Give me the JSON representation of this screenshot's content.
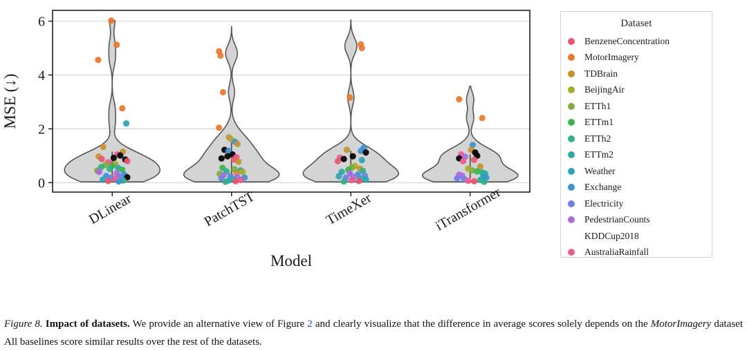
{
  "figure": {
    "caption_label": "Figure 8.",
    "caption_bold": "Impact of datasets.",
    "caption_part1": " We provide an alternative view of Figure ",
    "caption_link": "2",
    "caption_part2": " and clearly visualize that the difference in average scores solely depends on the ",
    "caption_italic": "MotorImagery",
    "caption_part3": " dataset All baselines score similar results over the rest of the datasets.",
    "link_color": "#1f4fd8"
  },
  "legend": {
    "title": "Dataset",
    "items": [
      {
        "label": "BenzeneConcentration",
        "color": "#e8566f"
      },
      {
        "label": "MotorImagery",
        "color": "#e8762c"
      },
      {
        "label": "TDBrain",
        "color": "#c4932e"
      },
      {
        "label": "BeijingAir",
        "color": "#a9ab2c"
      },
      {
        "label": "ETTh1",
        "color": "#7cb03a"
      },
      {
        "label": "ETTm1",
        "color": "#3cb44b"
      },
      {
        "label": "ETTh2",
        "color": "#2eb18a"
      },
      {
        "label": "ETTm2",
        "color": "#2fa9a0"
      },
      {
        "label": "Weather",
        "color": "#2ba3b6"
      },
      {
        "label": "Exchange",
        "color": "#3b93d4"
      },
      {
        "label": "Electricity",
        "color": "#6f7fe0"
      },
      {
        "label": "PedestrianCounts",
        "color": "#a66ce0"
      },
      {
        "label": "KDDCup2018",
        "color": "#e martin"
      },
      {
        "label": "AustraliaRainfall",
        "color": "#ec5a92"
      }
    ]
  },
  "chart_data": {
    "type": "violin",
    "title": "",
    "xlabel": "Model",
    "ylabel": "MSE (↓)",
    "ylim": [
      -0.35,
      6.4
    ],
    "yticks": [
      0,
      2,
      4,
      6
    ],
    "ytick_labels": [
      "0",
      "2",
      "4",
      "6"
    ],
    "grid": "horizontal",
    "xtick_rotation": -30,
    "categories": [
      "DLinear",
      "PatchTST",
      "TimeXer",
      "iTransformer"
    ],
    "violin_fill": "#cccccc",
    "violin_edge": "#555555",
    "series": [
      {
        "name": "DLinear",
        "median": 0.62,
        "max": 6.02,
        "min": 0.03,
        "points": [
          {
            "dataset": "MotorImagery",
            "value": 6.02,
            "jitter": -0.02
          },
          {
            "dataset": "MotorImagery",
            "value": 5.12,
            "jitter": 0.09
          },
          {
            "dataset": "MotorImagery",
            "value": 4.56,
            "jitter": -0.28
          },
          {
            "dataset": "MotorImagery",
            "value": 2.76,
            "jitter": 0.2
          },
          {
            "dataset": "Weather",
            "value": 2.2,
            "jitter": 0.28
          },
          {
            "dataset": "TDBrain",
            "value": 1.33,
            "jitter": -0.18
          },
          {
            "dataset": "TDBrain",
            "value": 1.15,
            "jitter": 0.21
          },
          {
            "dataset": "TDBrain",
            "value": 0.97,
            "jitter": -0.27
          },
          {
            "dataset": "AustraliaRainfall",
            "value": 1.05,
            "jitter": 0.1
          },
          {
            "dataset": "KDDCup2018",
            "value": 1.01,
            "jitter": 0.16
          },
          {
            "dataset": "KDDCup2018",
            "value": 0.92,
            "jitter": 0.03
          },
          {
            "dataset": "KDDCup2018",
            "value": 0.86,
            "jitter": 0.26
          },
          {
            "dataset": "BenzeneConcentration",
            "value": 0.88,
            "jitter": -0.21
          },
          {
            "dataset": "BenzeneConcentration",
            "value": 0.8,
            "jitter": 0.3
          },
          {
            "dataset": "AustraliaRainfall",
            "value": 0.76,
            "jitter": -0.08
          },
          {
            "dataset": "BeijingAir",
            "value": 0.7,
            "jitter": 0.06
          },
          {
            "dataset": "ETTh1",
            "value": 0.66,
            "jitter": -0.14
          },
          {
            "dataset": "ETTm1",
            "value": 0.62,
            "jitter": 0.0
          },
          {
            "dataset": "ETTh2",
            "value": 0.58,
            "jitter": -0.22
          },
          {
            "dataset": "ETTm2",
            "value": 0.55,
            "jitter": 0.12
          },
          {
            "dataset": "ETTh2",
            "value": 0.51,
            "jitter": -0.05
          },
          {
            "dataset": "ETTm1",
            "value": 0.48,
            "jitter": 0.2
          },
          {
            "dataset": "ETTh1",
            "value": 0.45,
            "jitter": -0.3
          },
          {
            "dataset": "PedestrianCounts",
            "value": 0.4,
            "jitter": -0.26
          },
          {
            "dataset": "PedestrianCounts",
            "value": 0.35,
            "jitter": 0.09
          },
          {
            "dataset": "Exchange",
            "value": 0.3,
            "jitter": 0.24
          },
          {
            "dataset": "Exchange",
            "value": 0.25,
            "jitter": -0.12
          },
          {
            "dataset": "Electricity",
            "value": 0.22,
            "jitter": 0.16
          },
          {
            "dataset": "Electricity",
            "value": 0.18,
            "jitter": -0.02
          },
          {
            "dataset": "KDDCup2018",
            "value": 0.2,
            "jitter": 0.3
          },
          {
            "dataset": "AustraliaRainfall",
            "value": 0.14,
            "jitter": 0.06
          },
          {
            "dataset": "Weather",
            "value": 0.11,
            "jitter": -0.19
          },
          {
            "dataset": "ETTm2",
            "value": 0.08,
            "jitter": 0.22
          },
          {
            "dataset": "BenzeneConcentration",
            "value": 0.06,
            "jitter": -0.08
          },
          {
            "dataset": "Exchange",
            "value": 0.04,
            "jitter": 0.13
          }
        ]
      },
      {
        "name": "PatchTST",
        "median": 0.55,
        "max": 5.8,
        "min": 0.03,
        "points": [
          {
            "dataset": "MotorImagery",
            "value": 4.88,
            "jitter": -0.25
          },
          {
            "dataset": "MotorImagery",
            "value": 4.72,
            "jitter": -0.22
          },
          {
            "dataset": "MotorImagery",
            "value": 3.36,
            "jitter": -0.17
          },
          {
            "dataset": "MotorImagery",
            "value": 2.04,
            "jitter": -0.25
          },
          {
            "dataset": "TDBrain",
            "value": 1.68,
            "jitter": -0.05
          },
          {
            "dataset": "BeijingAir",
            "value": 1.6,
            "jitter": 0.0
          },
          {
            "dataset": "Exchange",
            "value": 1.52,
            "jitter": 0.07
          },
          {
            "dataset": "TDBrain",
            "value": 1.44,
            "jitter": 0.12
          },
          {
            "dataset": "KDDCup2018",
            "value": 1.22,
            "jitter": -0.14
          },
          {
            "dataset": "Exchange",
            "value": 1.18,
            "jitter": -0.06
          },
          {
            "dataset": "KDDCup2018",
            "value": 1.05,
            "jitter": 0.02
          },
          {
            "dataset": "KDDCup2018",
            "value": 0.98,
            "jitter": -0.08
          },
          {
            "dataset": "AustraliaRainfall",
            "value": 0.95,
            "jitter": 0.1
          },
          {
            "dataset": "KDDCup2018",
            "value": 0.9,
            "jitter": -0.2
          },
          {
            "dataset": "BenzeneConcentration",
            "value": 0.86,
            "jitter": 0.05
          },
          {
            "dataset": "TDBrain",
            "value": 0.78,
            "jitter": 0.14
          },
          {
            "dataset": "ETTm1",
            "value": 0.55,
            "jitter": -0.18
          },
          {
            "dataset": "ETTh1",
            "value": 0.5,
            "jitter": 0.06
          },
          {
            "dataset": "ETTm2",
            "value": 0.46,
            "jitter": 0.18
          },
          {
            "dataset": "ETTh2",
            "value": 0.42,
            "jitter": -0.1
          },
          {
            "dataset": "BeijingAir",
            "value": 0.4,
            "jitter": 0.22
          },
          {
            "dataset": "TDBrain",
            "value": 0.37,
            "jitter": 0.1
          },
          {
            "dataset": "ETTh1",
            "value": 0.33,
            "jitter": -0.24
          },
          {
            "dataset": "PedestrianCounts",
            "value": 0.28,
            "jitter": -0.16
          },
          {
            "dataset": "Electricity",
            "value": 0.24,
            "jitter": -0.02
          },
          {
            "dataset": "PedestrianCounts",
            "value": 0.21,
            "jitter": 0.12
          },
          {
            "dataset": "Exchange",
            "value": 0.19,
            "jitter": 0.26
          },
          {
            "dataset": "Electricity",
            "value": 0.16,
            "jitter": -0.2
          },
          {
            "dataset": "ETTm2",
            "value": 0.13,
            "jitter": 0.04
          },
          {
            "dataset": "AustraliaRainfall",
            "value": 0.1,
            "jitter": 0.18
          },
          {
            "dataset": "Weather",
            "value": 0.08,
            "jitter": -0.06
          },
          {
            "dataset": "BenzeneConcentration",
            "value": 0.05,
            "jitter": 0.08
          },
          {
            "dataset": "ETTh2",
            "value": 0.03,
            "jitter": -0.12
          }
        ]
      },
      {
        "name": "TimeXer",
        "median": 0.52,
        "max": 6.05,
        "min": 0.03,
        "points": [
          {
            "dataset": "MotorImagery",
            "value": 5.14,
            "jitter": 0.2
          },
          {
            "dataset": "MotorImagery",
            "value": 5.0,
            "jitter": 0.22
          },
          {
            "dataset": "MotorImagery",
            "value": 3.16,
            "jitter": -0.02
          },
          {
            "dataset": "Exchange",
            "value": 1.3,
            "jitter": 0.26
          },
          {
            "dataset": "TDBrain",
            "value": 1.22,
            "jitter": -0.08
          },
          {
            "dataset": "Exchange",
            "value": 1.18,
            "jitter": 0.2
          },
          {
            "dataset": "KDDCup2018",
            "value": 1.12,
            "jitter": 0.3
          },
          {
            "dataset": "KDDCup2018",
            "value": 0.98,
            "jitter": 0.04
          },
          {
            "dataset": "AustraliaRainfall",
            "value": 0.93,
            "jitter": -0.22
          },
          {
            "dataset": "KDDCup2018",
            "value": 0.88,
            "jitter": -0.14
          },
          {
            "dataset": "Weather",
            "value": 0.84,
            "jitter": 0.22
          },
          {
            "dataset": "BenzeneConcentration",
            "value": 0.8,
            "jitter": -0.26
          },
          {
            "dataset": "BeijingAir",
            "value": 0.62,
            "jitter": 0.08
          },
          {
            "dataset": "ETTh1",
            "value": 0.56,
            "jitter": 0.02
          },
          {
            "dataset": "TDBrain",
            "value": 0.52,
            "jitter": 0.18
          },
          {
            "dataset": "ETTm1",
            "value": 0.48,
            "jitter": -0.05
          },
          {
            "dataset": "ETTh2",
            "value": 0.44,
            "jitter": 0.24
          },
          {
            "dataset": "ETTm2",
            "value": 0.4,
            "jitter": -0.18
          },
          {
            "dataset": "PedestrianCounts",
            "value": 0.34,
            "jitter": -0.02
          },
          {
            "dataset": "Exchange",
            "value": 0.3,
            "jitter": 0.14
          },
          {
            "dataset": "Electricity",
            "value": 0.26,
            "jitter": 0.28
          },
          {
            "dataset": "Weather",
            "value": 0.24,
            "jitter": -0.24
          },
          {
            "dataset": "PedestrianCounts",
            "value": 0.21,
            "jitter": 0.06
          },
          {
            "dataset": "Electricity",
            "value": 0.18,
            "jitter": -0.1
          },
          {
            "dataset": "ETTm2",
            "value": 0.15,
            "jitter": 0.2
          },
          {
            "dataset": "Weather",
            "value": 0.12,
            "jitter": 0.3
          },
          {
            "dataset": "AustraliaRainfall",
            "value": 0.09,
            "jitter": 0.02
          },
          {
            "dataset": "BenzeneConcentration",
            "value": 0.06,
            "jitter": 0.16
          },
          {
            "dataset": "ETTh2",
            "value": 0.04,
            "jitter": -0.14
          }
        ]
      },
      {
        "name": "iTransformer",
        "median": 0.4,
        "max": 3.58,
        "min": 0.03,
        "points": [
          {
            "dataset": "MotorImagery",
            "value": 3.1,
            "jitter": -0.22
          },
          {
            "dataset": "MotorImagery",
            "value": 2.4,
            "jitter": 0.24
          },
          {
            "dataset": "Exchange",
            "value": 1.4,
            "jitter": 0.05
          },
          {
            "dataset": "TDBrain",
            "value": 1.22,
            "jitter": 0.02
          },
          {
            "dataset": "KDDCup2018",
            "value": 1.12,
            "jitter": 0.1
          },
          {
            "dataset": "AustraliaRainfall",
            "value": 1.05,
            "jitter": -0.18
          },
          {
            "dataset": "KDDCup2018",
            "value": 1.0,
            "jitter": 0.14
          },
          {
            "dataset": "PedestrianCounts",
            "value": 0.96,
            "jitter": -0.1
          },
          {
            "dataset": "KDDCup2018",
            "value": 0.9,
            "jitter": -0.22
          },
          {
            "dataset": "BenzeneConcentration",
            "value": 0.85,
            "jitter": 0.08
          },
          {
            "dataset": "AustraliaRainfall",
            "value": 0.8,
            "jitter": -0.14
          },
          {
            "dataset": "TDBrain",
            "value": 0.6,
            "jitter": 0.2
          },
          {
            "dataset": "BeijingAir",
            "value": 0.52,
            "jitter": -0.04
          },
          {
            "dataset": "ETTh1",
            "value": 0.46,
            "jitter": 0.04
          },
          {
            "dataset": "ETTm1",
            "value": 0.42,
            "jitter": 0.14
          },
          {
            "dataset": "ETTh2",
            "value": 0.38,
            "jitter": 0.24
          },
          {
            "dataset": "ETTm2",
            "value": 0.34,
            "jitter": 0.3
          },
          {
            "dataset": "PedestrianCounts",
            "value": 0.3,
            "jitter": -0.22
          },
          {
            "dataset": "PedestrianCounts",
            "value": 0.26,
            "jitter": -0.16
          },
          {
            "dataset": "Weather",
            "value": 0.22,
            "jitter": 0.26
          },
          {
            "dataset": "Exchange",
            "value": 0.19,
            "jitter": 0.32
          },
          {
            "dataset": "Electricity",
            "value": 0.16,
            "jitter": -0.26
          },
          {
            "dataset": "Electricity",
            "value": 0.13,
            "jitter": -0.12
          },
          {
            "dataset": "ETTm2",
            "value": 0.1,
            "jitter": 0.2
          },
          {
            "dataset": "AustraliaRainfall",
            "value": 0.07,
            "jitter": -0.04
          },
          {
            "dataset": "BenzeneConcentration",
            "value": 0.05,
            "jitter": 0.08
          },
          {
            "dataset": "ETTh2",
            "value": 0.03,
            "jitter": 0.28
          }
        ]
      }
    ]
  }
}
